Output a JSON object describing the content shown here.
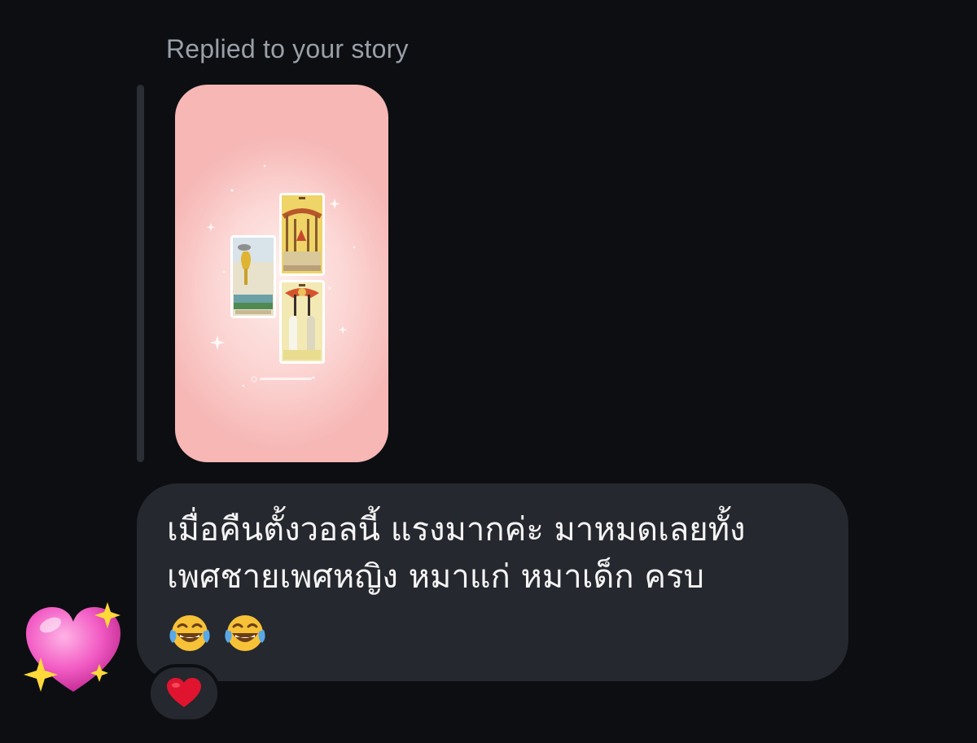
{
  "header": {
    "reply_label": "Replied to your story"
  },
  "story": {
    "kind": "story-thumbnail",
    "background_color": "#fbd3d1",
    "cards": [
      "tarot-card-cups",
      "tarot-card-wands",
      "tarot-card-lovers"
    ]
  },
  "message": {
    "text": "เมื่อคืนตั้งวอลนี้ แรงมากค่ะ มาหมดเลยทั้ง\nเพศชายเพศหญิง หมาแก่ หมาเด็ก ครบ",
    "emojis": [
      "face-with-tears-of-joy-icon",
      "face-with-tears-of-joy-icon"
    ],
    "bubble_color": "#25282e",
    "text_color": "#f4f4f4"
  },
  "reaction": {
    "icon": "red-heart-icon",
    "color": "#e0142e"
  },
  "sender": {
    "avatar_icon": "sparkling-heart-icon",
    "color": "#f25cc4"
  },
  "colors": {
    "background": "#0c0e12",
    "muted_text": "#9aa0a8"
  }
}
